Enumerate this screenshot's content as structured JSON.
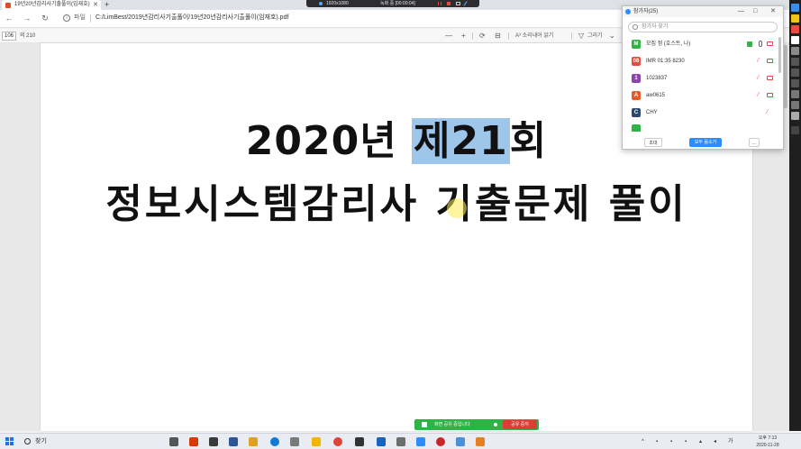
{
  "browser": {
    "tab_title": "19년20년감리사기출풀이(임재호)",
    "tab_close": "✕",
    "new_tab": "+",
    "address_label": "파일",
    "address_url": "C:/LimBest/2019년감리사기출풀이/19년20년감리사기출풀이(임재호).pdf"
  },
  "recorder": {
    "resolution": "1920x1080",
    "elapsed": "녹화 중 [00:00:04]"
  },
  "pdf_toolbar": {
    "page_current": "106",
    "page_total": "의 210",
    "zoom_out": "—",
    "zoom_in": "+",
    "read_aloud": "A³ 소리내어 읽기",
    "draw": "그리기"
  },
  "document": {
    "title_part1": "2020년 ",
    "title_highlight": "제21",
    "title_part2": "회",
    "subtitle": "정보시스템감리사 기출문제 풀이"
  },
  "participants_panel": {
    "title": "참가자(25)",
    "search_placeholder": "참가자 찾기",
    "participants": [
      {
        "initial": "M",
        "name": "모집 정 (호스트, 나)",
        "color": "#2fb344"
      },
      {
        "initial": "08",
        "name": "IMR 01:35 8230",
        "color": "#e84c3d"
      },
      {
        "initial": "1",
        "name": "1023837",
        "color": "#8e44ad"
      },
      {
        "initial": "A",
        "name": "aw0615",
        "color": "#e55b2d"
      },
      {
        "initial": "C",
        "name": "CHY",
        "color": "#2c4a6e"
      }
    ],
    "invite_label": "초대",
    "mute_all_label": "모두 음소거",
    "more_label": "..."
  },
  "share_bar": {
    "status": "화면 공유 중입니다",
    "stop_label": "공유 중지"
  },
  "taskbar": {
    "search": "찾기",
    "time": "오후 7:13",
    "date": "2020-11-28"
  }
}
